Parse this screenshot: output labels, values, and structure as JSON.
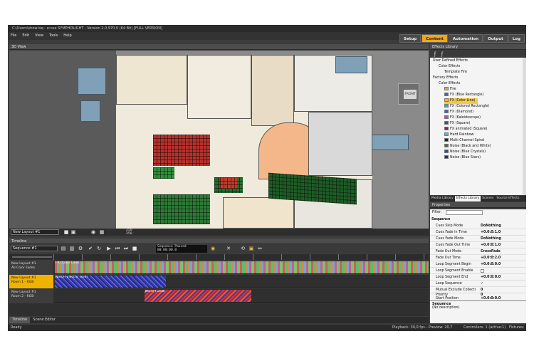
{
  "window": {
    "title": "C:\\Users\\show.lsq - e:cue SYMPHOLIGHT - Version 2.0.970.0 (64 Bit) [FULL VERSION]"
  },
  "menu": [
    "File",
    "Edit",
    "View",
    "Tools",
    "Help"
  ],
  "top_tabs": [
    {
      "label": "Setup",
      "active": false
    },
    {
      "label": "Content",
      "active": true
    },
    {
      "label": "Automation",
      "active": false
    },
    {
      "label": "Output",
      "active": false
    },
    {
      "label": "Log",
      "active": false
    }
  ],
  "view3d": {
    "title": "3D View",
    "cube_label": "FRONT",
    "layout_select": "New Layout #1",
    "zoom_values": [
      "250",
      "250"
    ]
  },
  "timeline": {
    "title": "Timeline",
    "sequence_select": "Sequence #1",
    "status_line1": "Sequence Paused",
    "status_line2": "00:00:00.0",
    "tracks": [
      {
        "name": "New Layout #1",
        "sub": "All Color Fades",
        "selected": false,
        "clip_label": "FX (Color Line)"
      },
      {
        "name": "New Layout #1",
        "sub": "Room 1 - RGB",
        "selected": true,
        "clip_label": "Noise (Electric Grid)"
      },
      {
        "name": "New Layout #1",
        "sub": "Room 2 - RGB",
        "selected": false,
        "clip_label": "Noise (Lava)"
      }
    ]
  },
  "bottom_tabs": [
    {
      "label": "Timeline",
      "active": true
    },
    {
      "label": "Scene Editor",
      "active": false
    }
  ],
  "status": {
    "left": "Ready",
    "playback": "Playback: 30,0 fps - Preview: 20,7",
    "controllers": "Controllers: 1 (active:1)",
    "fixtures": "Fixtures: 350"
  },
  "effects_library": {
    "title": "Effects Library",
    "user_defined": "User Defined Effects",
    "user_color_effects": "Color Effects",
    "template_fire": "Template Fire",
    "factory": "Factory Effects",
    "factory_color_effects": "Color Effects",
    "items": [
      {
        "label": "Fire",
        "color": "#e8a040",
        "selected": false
      },
      {
        "label": "FX (Blue Rectangle)",
        "color": "#4060c0",
        "selected": false
      },
      {
        "label": "FX (Color Line)",
        "color": "#e8b830",
        "selected": true
      },
      {
        "label": "FX (Colored Rectangle)",
        "color": "#30b0b0",
        "selected": false
      },
      {
        "label": "FX (Diamond)",
        "color": "#3060e0",
        "selected": false
      },
      {
        "label": "FX (Kaleidoscope)",
        "color": "#b050c0",
        "selected": false
      },
      {
        "label": "FX (Square)",
        "color": "#5040a0",
        "selected": false
      },
      {
        "label": "FX animated (Square)",
        "color": "#802060",
        "selected": false
      },
      {
        "label": "Hard Rainbow",
        "color": "#40c0e0",
        "selected": false
      },
      {
        "label": "Multi Channel Spiral",
        "color": "#202020",
        "selected": false
      },
      {
        "label": "Noise (Black and White)",
        "color": "#606060",
        "selected": false
      },
      {
        "label": "Noise (Blue Crystals)",
        "color": "#3050a0",
        "selected": false
      },
      {
        "label": "Noise (Blue Stars)",
        "color": "#203080",
        "selected": false
      }
    ],
    "tabs": [
      {
        "label": "Media Library",
        "active": false
      },
      {
        "label": "Effects Library",
        "active": true
      },
      {
        "label": "Scenes",
        "active": false
      },
      {
        "label": "Source Effects",
        "active": false
      }
    ]
  },
  "properties": {
    "title": "Properties",
    "filter_label": "Filter:",
    "section": "Sequence",
    "rows": [
      {
        "key": "Cues Skip Mode",
        "value": "DoNothing"
      },
      {
        "key": "Cues Fade In Time",
        "value": "+0.0:0:1.0"
      },
      {
        "key": "Cues Fade Mode",
        "value": "DoNothing"
      },
      {
        "key": "Cues Fade Out Time",
        "value": "+0.0:0:1.0"
      },
      {
        "key": "Fade Out Mode",
        "value": "CrossFade"
      },
      {
        "key": "Fade Out Time",
        "value": "+0.0:0:2.0"
      },
      {
        "key": "Loop Segment Begin",
        "value": "+0.0:0:0.0"
      },
      {
        "key": "Loop Segment Enable",
        "value": ""
      },
      {
        "key": "Loop Segment End",
        "value": "+0.0:0:0.0"
      },
      {
        "key": "Loop Sequence",
        "value": "✓"
      },
      {
        "key": "Mutual Exclude Collecti",
        "value": "0"
      },
      {
        "key": "Opacity",
        "value": "100"
      },
      {
        "key": "Priority",
        "value": "0"
      },
      {
        "key": "Start Position",
        "value": "+0.0:0:0.0"
      }
    ],
    "desc_title": "Sequence",
    "desc_text": "(No description)"
  }
}
